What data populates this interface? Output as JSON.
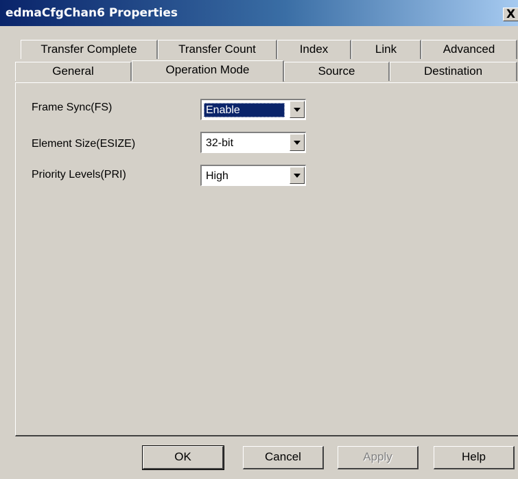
{
  "window": {
    "title": "edmaCfgChan6 Properties",
    "close_glyph": "X"
  },
  "tabs_row_back": [
    "Transfer Complete",
    "Transfer Count",
    "Index",
    "Link",
    "Advanced"
  ],
  "tabs_row_front": [
    "General",
    "Operation Mode",
    "Source",
    "Destination"
  ],
  "active_tab": "Operation Mode",
  "fields": [
    {
      "label": "Frame Sync(FS)",
      "value": "Enable",
      "focused": true
    },
    {
      "label": "Element Size(ESIZE)",
      "value": "32-bit",
      "focused": false
    },
    {
      "label": "Priority Levels(PRI)",
      "value": "High",
      "focused": false
    }
  ],
  "buttons": {
    "ok": "OK",
    "cancel": "Cancel",
    "apply": "Apply",
    "help": "Help"
  },
  "colors": {
    "titlebar_start": "#0a246a",
    "face": "#d4d0c8",
    "selection": "#0a246a"
  }
}
